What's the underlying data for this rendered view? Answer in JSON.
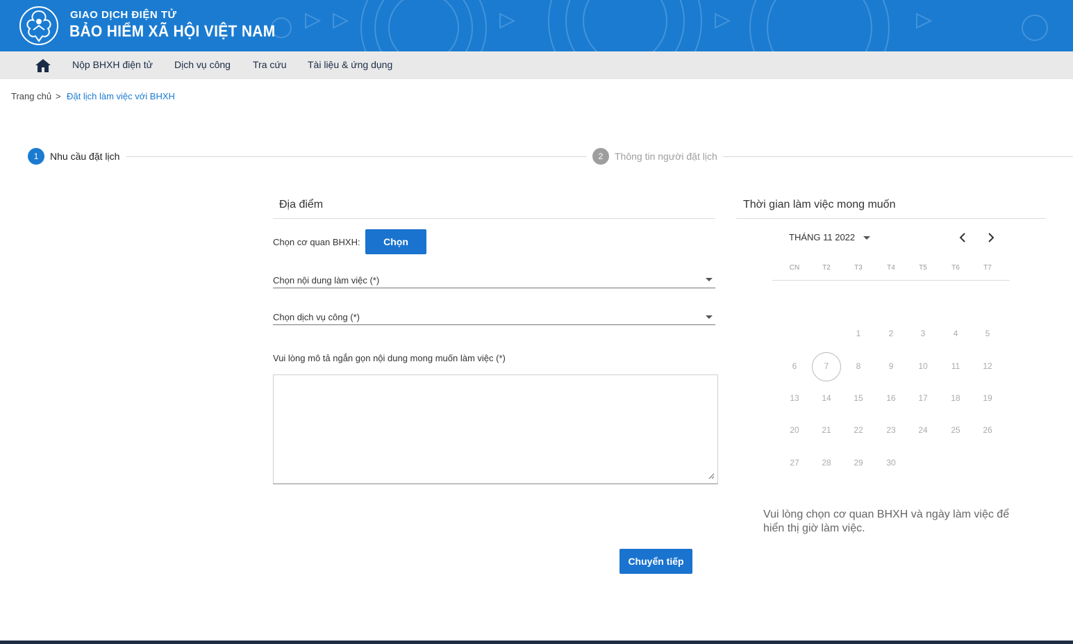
{
  "header": {
    "title_top": "GIAO DỊCH ĐIỆN TỬ",
    "title_main": "BẢO HIỂM XÃ HỘI VIỆT NAM",
    "color": "#1a7bd1"
  },
  "nav": {
    "items": [
      "Nộp BHXH điện tử",
      "Dịch vụ công",
      "Tra cứu",
      "Tài liệu & ứng dụng"
    ]
  },
  "breadcrumb": {
    "home": "Trang chủ",
    "separator": ">",
    "current": "Đặt lịch làm việc với BHXH"
  },
  "stepper": {
    "steps": [
      {
        "number": "1",
        "label": "Nhu cầu đặt lịch",
        "active": true
      },
      {
        "number": "2",
        "label": "Thông tin người đặt lịch",
        "active": false
      }
    ]
  },
  "location": {
    "title": "Địa điểm",
    "agency_label": "Chọn cơ quan BHXH:",
    "choose_button": "Chọn",
    "content_select": "Chọn nội dung làm việc (*)",
    "service_select": "Chọn dịch vụ công (*)",
    "description_label": "Vui lòng mô tả ngắn gọn nội dung mong muốn làm việc (*)",
    "description_value": "",
    "next_button": "Chuyển tiếp"
  },
  "calendar": {
    "title": "Thời gian làm việc mong muốn",
    "month_label": "THÁNG 11 2022",
    "weekdays": [
      "CN",
      "T2",
      "T3",
      "T4",
      "T5",
      "T6",
      "T7"
    ],
    "days": [
      "1",
      "2",
      "3",
      "4",
      "5",
      "6",
      "7",
      "8",
      "9",
      "10",
      "11",
      "12",
      "13",
      "14",
      "15",
      "16",
      "17",
      "18",
      "19",
      "20",
      "21",
      "22",
      "23",
      "24",
      "25",
      "26",
      "27",
      "28",
      "29",
      "30"
    ],
    "today": "7",
    "note": "Vui lòng chọn cơ quan BHXH và ngày làm việc để hiển thị giờ làm việc."
  },
  "icons": {
    "home": "home-icon",
    "prev": "chevron-left-icon",
    "next": "chevron-right-icon",
    "dropdown": "caret-down-icon"
  }
}
